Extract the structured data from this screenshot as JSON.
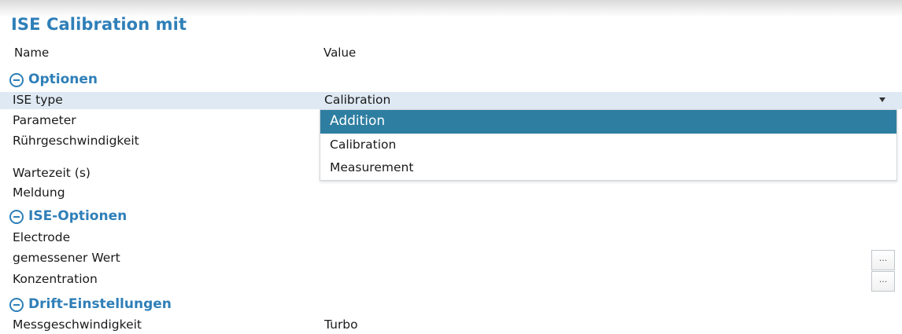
{
  "window": {
    "title": "ISE Calibration mit"
  },
  "columns": {
    "name": "Name",
    "value": "Value"
  },
  "sections": {
    "optionen": {
      "title": "Optionen",
      "icon": "collapse-circle-minus-icon"
    },
    "ise_optionen": {
      "title": "ISE-Optionen",
      "icon": "collapse-circle-minus-icon"
    },
    "drift": {
      "title": "Drift-Einstellungen",
      "icon": "collapse-circle-minus-icon"
    }
  },
  "rows": {
    "ise_type": {
      "label": "ISE type",
      "value": "Calibration"
    },
    "parameter": {
      "label": "Parameter"
    },
    "ruehr": {
      "label": "Rührgeschwindigkeit"
    },
    "wartezeit": {
      "label": "Wartezeit (s)"
    },
    "meldung": {
      "label": "Meldung"
    },
    "electrode": {
      "label": "Electrode"
    },
    "gemessener": {
      "label": "gemessener Wert",
      "button": "..."
    },
    "konzentration": {
      "label": "Konzentration",
      "button": "..."
    },
    "messgeschw": {
      "label": "Messgeschwindigkeit",
      "value": "Turbo"
    }
  },
  "dropdown": {
    "options": [
      "Addition",
      "Calibration",
      "Measurement"
    ],
    "highlighted": "Addition"
  },
  "colors": {
    "accent": "#2f7fb8",
    "highlight": "#2e7ea1",
    "selected_row": "#dfe9f3"
  }
}
